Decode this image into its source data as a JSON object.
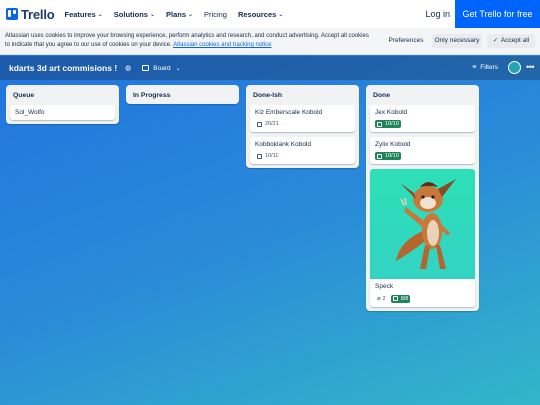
{
  "nav": {
    "logo_text": "Trello",
    "items": [
      {
        "label": "Features",
        "dropdown": true
      },
      {
        "label": "Solutions",
        "dropdown": true
      },
      {
        "label": "Plans",
        "dropdown": true
      },
      {
        "label": "Pricing",
        "dropdown": false
      },
      {
        "label": "Resources",
        "dropdown": true
      }
    ],
    "login_label": "Log in",
    "cta_label": "Get Trello for free"
  },
  "cookie": {
    "text": "Atlassian uses cookies to improve your browsing experience, perform analytics and research, and conduct advertising. Accept all cookies to indicate that you agree to our use of cookies on your device.",
    "link": "Atlassian cookies and tracking notice",
    "preferences": "Preferences",
    "only_necessary": "Only necessary",
    "accept_all": "Accept all"
  },
  "board": {
    "title": "kdarts 3d art commisions !",
    "view_label": "Board",
    "filters_label": "Filters",
    "more_label": "•••"
  },
  "lists": [
    {
      "title": "Queue",
      "cards": [
        {
          "title": "Sol_Wolfo"
        }
      ]
    },
    {
      "title": "In Progress",
      "cards": []
    },
    {
      "title": "Done-Ish",
      "cards": [
        {
          "title": "Kiz Emberscale Kobold",
          "checklist": "20/21"
        },
        {
          "title": "Kobboklank Kobold",
          "checklist": "10/11"
        }
      ]
    },
    {
      "title": "Done",
      "cards": [
        {
          "title": "Jex Kobold",
          "checklist": "10/10"
        },
        {
          "title": "Zylix Kobold",
          "checklist": "10/10"
        },
        {
          "title": "Speck",
          "attachments": "2",
          "checklist": "8/8"
        }
      ]
    }
  ],
  "colors": {
    "accent": "#0065ff",
    "complete": "#1f845a",
    "cover": "#2de0b6"
  }
}
